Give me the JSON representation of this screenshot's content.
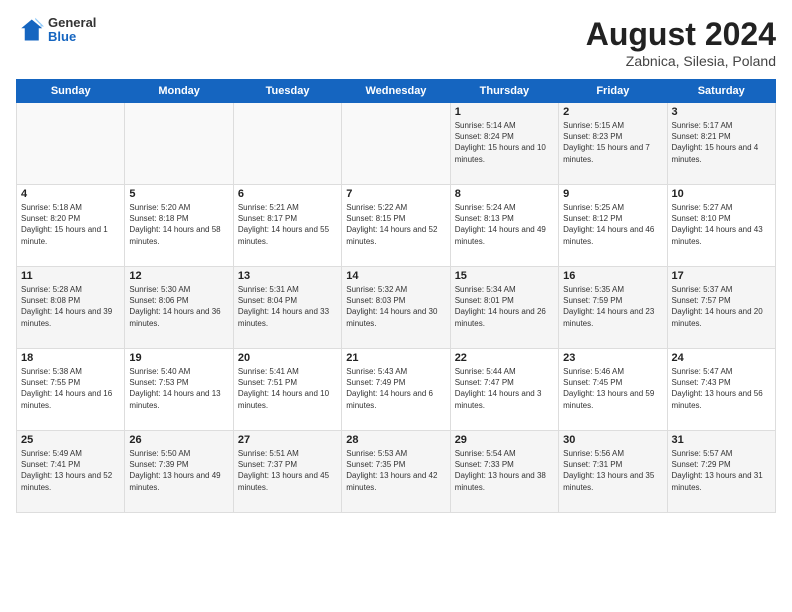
{
  "header": {
    "logo_line1": "General",
    "logo_line2": "Blue",
    "title": "August 2024",
    "subtitle": "Zabnica, Silesia, Poland"
  },
  "weekdays": [
    "Sunday",
    "Monday",
    "Tuesday",
    "Wednesday",
    "Thursday",
    "Friday",
    "Saturday"
  ],
  "weeks": [
    [
      {
        "day": "",
        "info": "",
        "empty": true
      },
      {
        "day": "",
        "info": "",
        "empty": true
      },
      {
        "day": "",
        "info": "",
        "empty": true
      },
      {
        "day": "",
        "info": "",
        "empty": true
      },
      {
        "day": "1",
        "info": "Sunrise: 5:14 AM\nSunset: 8:24 PM\nDaylight: 15 hours and 10 minutes."
      },
      {
        "day": "2",
        "info": "Sunrise: 5:15 AM\nSunset: 8:23 PM\nDaylight: 15 hours and 7 minutes."
      },
      {
        "day": "3",
        "info": "Sunrise: 5:17 AM\nSunset: 8:21 PM\nDaylight: 15 hours and 4 minutes."
      }
    ],
    [
      {
        "day": "4",
        "info": "Sunrise: 5:18 AM\nSunset: 8:20 PM\nDaylight: 15 hours and 1 minute."
      },
      {
        "day": "5",
        "info": "Sunrise: 5:20 AM\nSunset: 8:18 PM\nDaylight: 14 hours and 58 minutes."
      },
      {
        "day": "6",
        "info": "Sunrise: 5:21 AM\nSunset: 8:17 PM\nDaylight: 14 hours and 55 minutes."
      },
      {
        "day": "7",
        "info": "Sunrise: 5:22 AM\nSunset: 8:15 PM\nDaylight: 14 hours and 52 minutes."
      },
      {
        "day": "8",
        "info": "Sunrise: 5:24 AM\nSunset: 8:13 PM\nDaylight: 14 hours and 49 minutes."
      },
      {
        "day": "9",
        "info": "Sunrise: 5:25 AM\nSunset: 8:12 PM\nDaylight: 14 hours and 46 minutes."
      },
      {
        "day": "10",
        "info": "Sunrise: 5:27 AM\nSunset: 8:10 PM\nDaylight: 14 hours and 43 minutes."
      }
    ],
    [
      {
        "day": "11",
        "info": "Sunrise: 5:28 AM\nSunset: 8:08 PM\nDaylight: 14 hours and 39 minutes."
      },
      {
        "day": "12",
        "info": "Sunrise: 5:30 AM\nSunset: 8:06 PM\nDaylight: 14 hours and 36 minutes."
      },
      {
        "day": "13",
        "info": "Sunrise: 5:31 AM\nSunset: 8:04 PM\nDaylight: 14 hours and 33 minutes."
      },
      {
        "day": "14",
        "info": "Sunrise: 5:32 AM\nSunset: 8:03 PM\nDaylight: 14 hours and 30 minutes."
      },
      {
        "day": "15",
        "info": "Sunrise: 5:34 AM\nSunset: 8:01 PM\nDaylight: 14 hours and 26 minutes."
      },
      {
        "day": "16",
        "info": "Sunrise: 5:35 AM\nSunset: 7:59 PM\nDaylight: 14 hours and 23 minutes."
      },
      {
        "day": "17",
        "info": "Sunrise: 5:37 AM\nSunset: 7:57 PM\nDaylight: 14 hours and 20 minutes."
      }
    ],
    [
      {
        "day": "18",
        "info": "Sunrise: 5:38 AM\nSunset: 7:55 PM\nDaylight: 14 hours and 16 minutes."
      },
      {
        "day": "19",
        "info": "Sunrise: 5:40 AM\nSunset: 7:53 PM\nDaylight: 14 hours and 13 minutes."
      },
      {
        "day": "20",
        "info": "Sunrise: 5:41 AM\nSunset: 7:51 PM\nDaylight: 14 hours and 10 minutes."
      },
      {
        "day": "21",
        "info": "Sunrise: 5:43 AM\nSunset: 7:49 PM\nDaylight: 14 hours and 6 minutes."
      },
      {
        "day": "22",
        "info": "Sunrise: 5:44 AM\nSunset: 7:47 PM\nDaylight: 14 hours and 3 minutes."
      },
      {
        "day": "23",
        "info": "Sunrise: 5:46 AM\nSunset: 7:45 PM\nDaylight: 13 hours and 59 minutes."
      },
      {
        "day": "24",
        "info": "Sunrise: 5:47 AM\nSunset: 7:43 PM\nDaylight: 13 hours and 56 minutes."
      }
    ],
    [
      {
        "day": "25",
        "info": "Sunrise: 5:49 AM\nSunset: 7:41 PM\nDaylight: 13 hours and 52 minutes."
      },
      {
        "day": "26",
        "info": "Sunrise: 5:50 AM\nSunset: 7:39 PM\nDaylight: 13 hours and 49 minutes."
      },
      {
        "day": "27",
        "info": "Sunrise: 5:51 AM\nSunset: 7:37 PM\nDaylight: 13 hours and 45 minutes."
      },
      {
        "day": "28",
        "info": "Sunrise: 5:53 AM\nSunset: 7:35 PM\nDaylight: 13 hours and 42 minutes."
      },
      {
        "day": "29",
        "info": "Sunrise: 5:54 AM\nSunset: 7:33 PM\nDaylight: 13 hours and 38 minutes."
      },
      {
        "day": "30",
        "info": "Sunrise: 5:56 AM\nSunset: 7:31 PM\nDaylight: 13 hours and 35 minutes."
      },
      {
        "day": "31",
        "info": "Sunrise: 5:57 AM\nSunset: 7:29 PM\nDaylight: 13 hours and 31 minutes."
      }
    ]
  ]
}
